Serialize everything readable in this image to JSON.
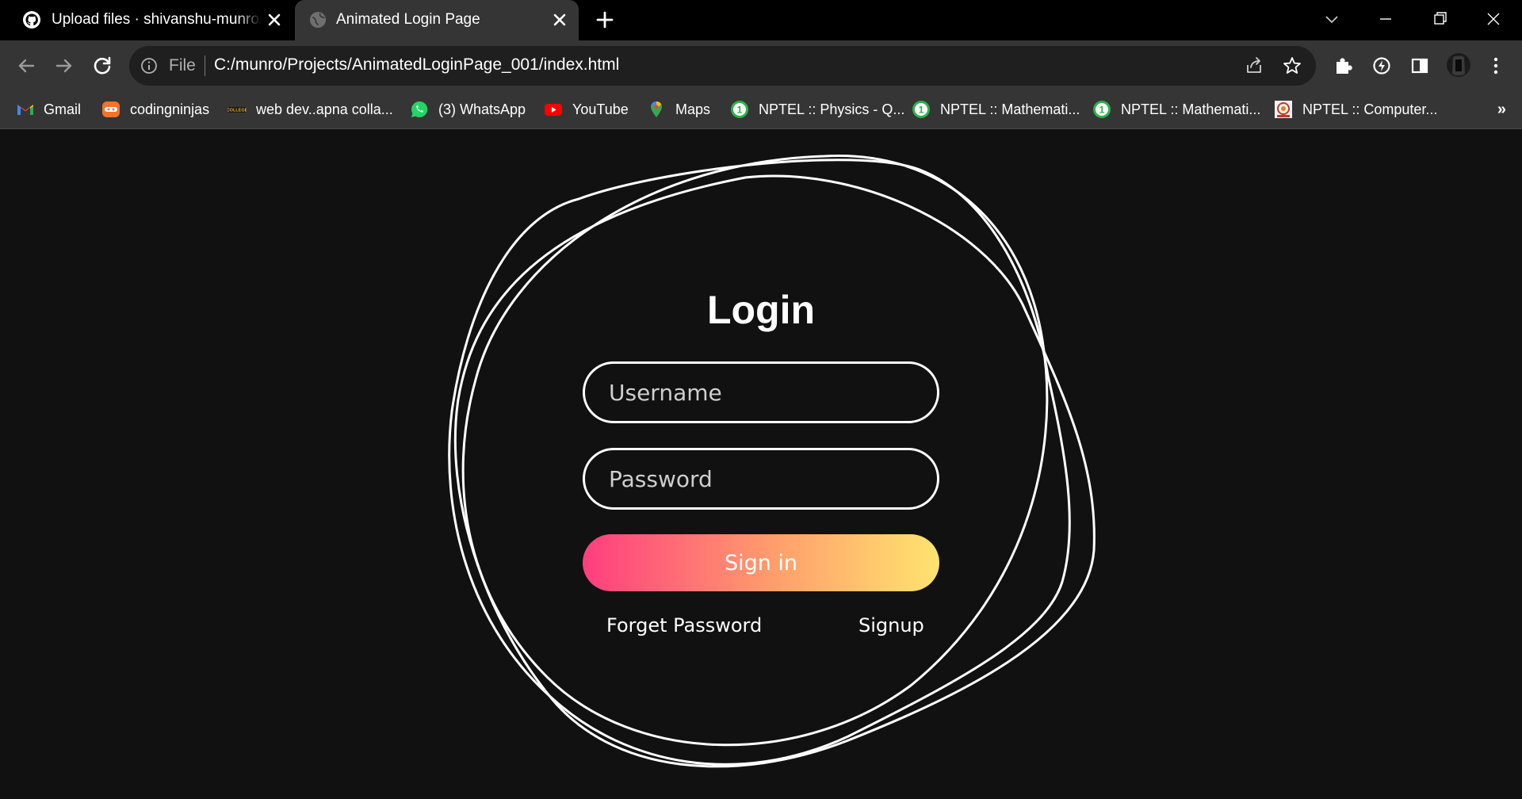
{
  "browser": {
    "tabs": [
      {
        "title": "Upload files · shivanshu-munro/A",
        "icon": "github-icon",
        "active": false
      },
      {
        "title": "Animated Login Page",
        "icon": "globe-icon",
        "active": true
      }
    ],
    "omnibox": {
      "scheme_label": "File",
      "url": "C:/munro/Projects/AnimatedLoginPage_001/index.html"
    },
    "bookmarks": [
      {
        "label": "Gmail",
        "icon": "gmail-icon"
      },
      {
        "label": "codingninjas",
        "icon": "codingninjas-icon"
      },
      {
        "label": "web dev..apna colla...",
        "icon": "apna-college-icon"
      },
      {
        "label": "(3) WhatsApp",
        "icon": "whatsapp-icon"
      },
      {
        "label": "YouTube",
        "icon": "youtube-icon"
      },
      {
        "label": "Maps",
        "icon": "maps-icon"
      },
      {
        "label": "NPTEL :: Physics - Q...",
        "icon": "nptel-icon"
      },
      {
        "label": "NPTEL :: Mathemati...",
        "icon": "nptel-icon"
      },
      {
        "label": "NPTEL :: Mathemati...",
        "icon": "nptel-icon"
      },
      {
        "label": "NPTEL :: Computer...",
        "icon": "nptel-computer-icon"
      }
    ],
    "bookmarks_overflow": "»"
  },
  "page": {
    "title": "Login",
    "username_placeholder": "Username",
    "password_placeholder": "Password",
    "signin_label": "Sign in",
    "forgot_label": "Forget Password",
    "signup_label": "Signup",
    "colors": {
      "background": "#111111",
      "ring": "#ffffff",
      "gradient_start": "#ff3d7f",
      "gradient_end": "#ffe46f"
    }
  }
}
